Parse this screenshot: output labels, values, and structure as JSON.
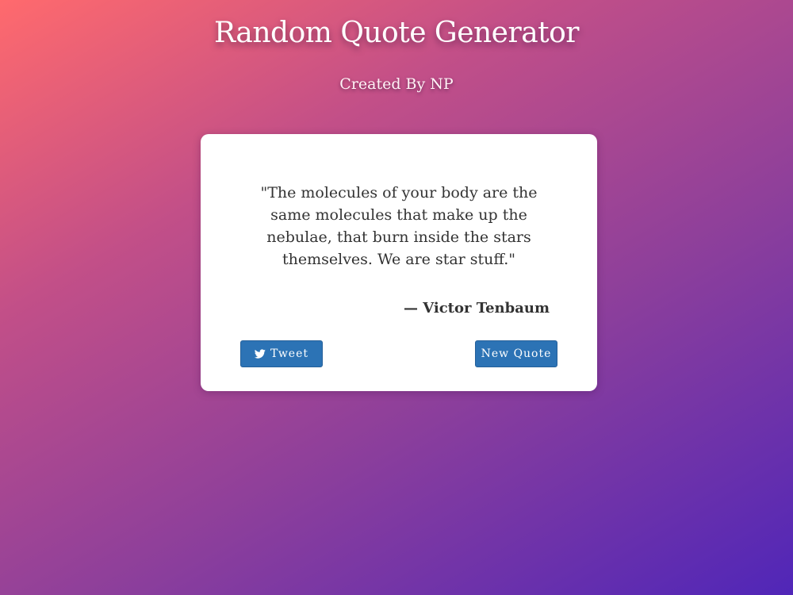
{
  "header": {
    "title": "Random Quote Generator",
    "subtitle": "Created By NP"
  },
  "quote_card": {
    "quote": "\"The molecules of your body are the same molecules that make up the nebulae, that burn inside the stars themselves. We are star stuff.\"",
    "author": "— Victor Tenbaum",
    "tweet_button": {
      "label": "Tweet",
      "icon": "twitter-icon"
    },
    "new_quote_button": {
      "label": "New Quote"
    }
  },
  "colors": {
    "gradient_start": "#ff6a6d",
    "gradient_end": "#5026b8",
    "button_blue": "#2c73b5",
    "card_background": "#ffffff",
    "text_dark": "#333333"
  }
}
